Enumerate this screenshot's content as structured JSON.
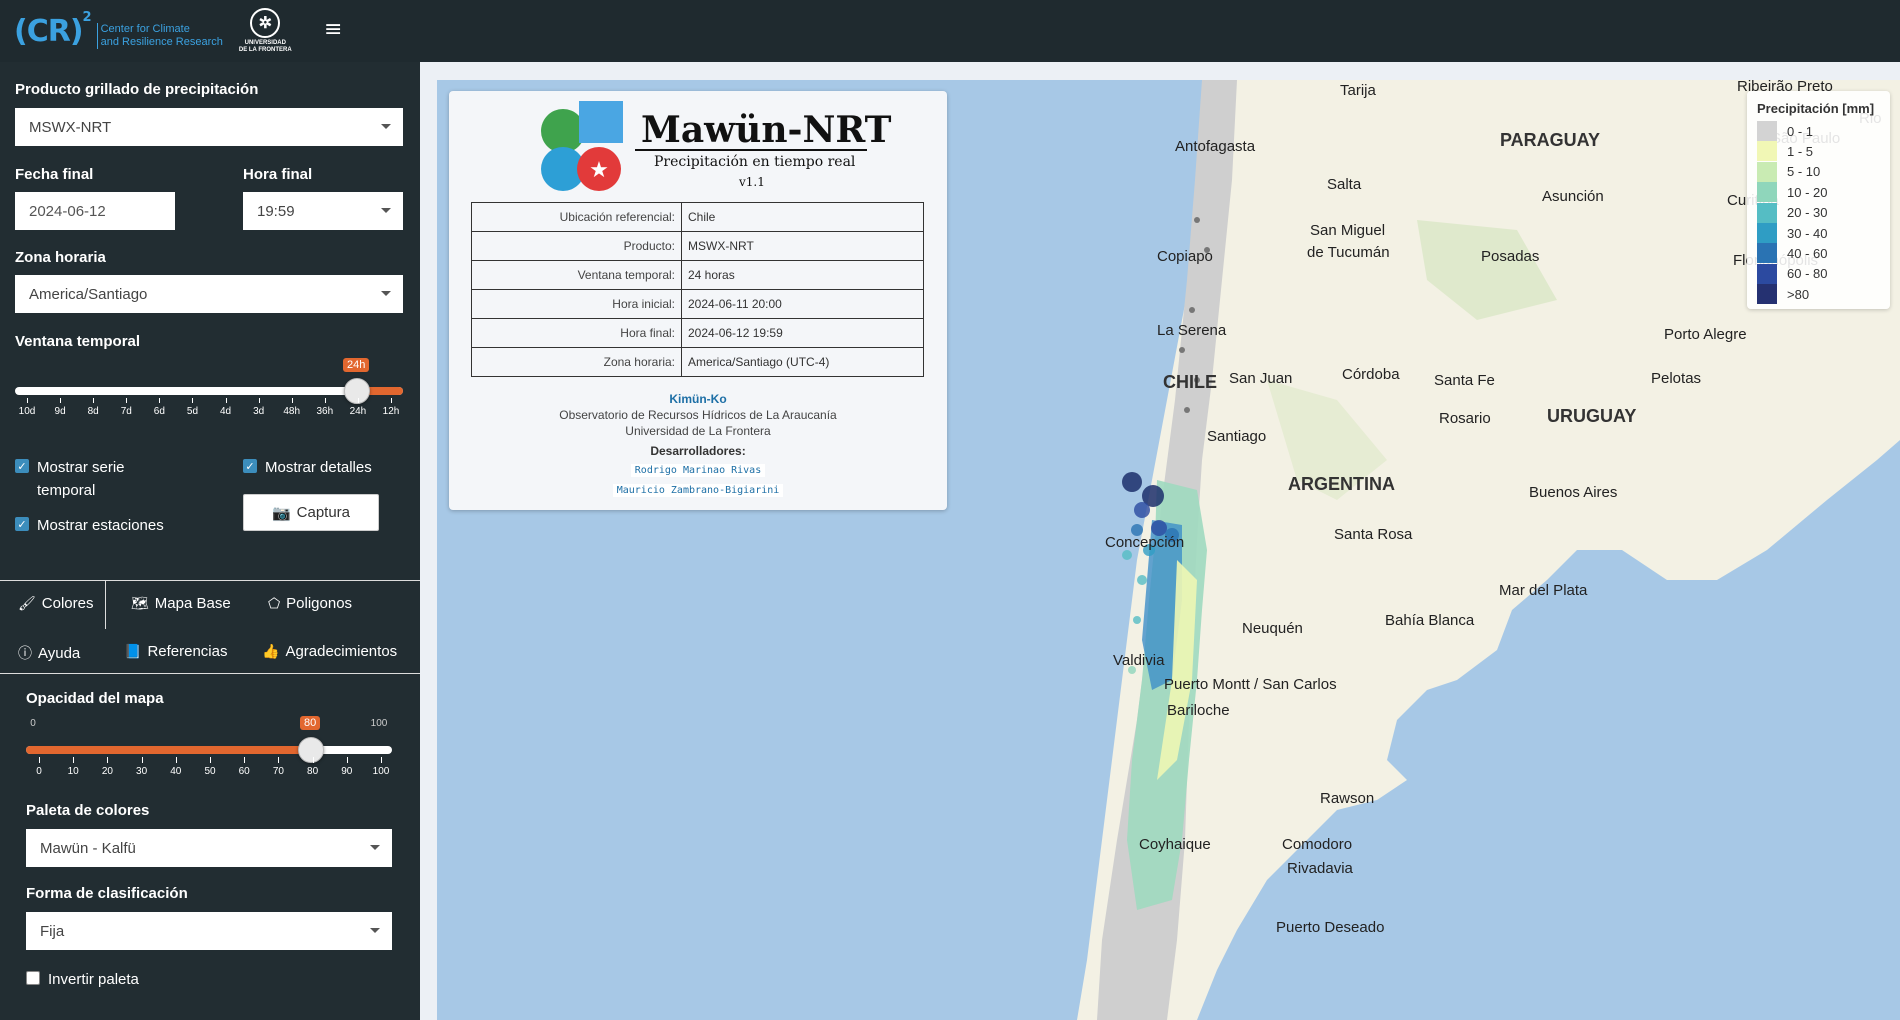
{
  "header": {
    "logo_mark": "(CR)",
    "logo_sup": "2",
    "logo_line1": "Center for Climate",
    "logo_line2": "and Resilience Research",
    "ufro_line1": "UNIVERSIDAD",
    "ufro_line2": "DE LA FRONTERA"
  },
  "sidebar": {
    "product_label": "Producto grillado de precipitación",
    "product_value": "MSWX-NRT",
    "date_label": "Fecha final",
    "date_value": "2024-06-12",
    "hour_label": "Hora final",
    "hour_value": "19:59",
    "tz_label": "Zona horaria",
    "tz_value": "America/Santiago",
    "window_label": "Ventana temporal",
    "window_value": "24h",
    "window_ticks": [
      "10d",
      "9d",
      "8d",
      "7d",
      "6d",
      "5d",
      "4d",
      "3d",
      "48h",
      "36h",
      "24h",
      "12h"
    ],
    "check_series": "Mostrar serie temporal",
    "check_series_line1": "Mostrar serie",
    "check_series_line2": "temporal",
    "check_details": "Mostrar detalles",
    "check_stations": "Mostrar estaciones",
    "capture_button": "Captura"
  },
  "tabs": [
    {
      "label": "Colores",
      "icon": "brush-icon",
      "active": true
    },
    {
      "label": "Mapa Base",
      "icon": "map-icon"
    },
    {
      "label": "Poligonos",
      "icon": "polygon-icon"
    },
    {
      "label": "Ayuda",
      "icon": "info-icon"
    },
    {
      "label": "Referencias",
      "icon": "book-icon"
    },
    {
      "label": "Agradecimientos",
      "icon": "thumbs-up-icon"
    }
  ],
  "colores": {
    "opacity_label": "Opacidad del mapa",
    "opacity_value": "80",
    "opacity_min": "0",
    "opacity_max": "100",
    "opacity_ticks": [
      "0",
      "10",
      "20",
      "30",
      "40",
      "50",
      "60",
      "70",
      "80",
      "90",
      "100"
    ],
    "palette_label": "Paleta de colores",
    "palette_value": "Mawün - Kalfü",
    "class_label": "Forma de clasificación",
    "class_value": "Fija",
    "invert_label": "Invertir paleta"
  },
  "info_card": {
    "title": "Mawün-NRT",
    "subtitle": "Precipitación en tiempo real",
    "version": "v1.1",
    "rows": [
      {
        "k": "Ubicación referencial:",
        "v": "Chile"
      },
      {
        "k": "Producto:",
        "v": "MSWX-NRT"
      },
      {
        "k": "Ventana temporal:",
        "v": "24 horas"
      },
      {
        "k": "Hora inicial:",
        "v": "2024-06-11 20:00"
      },
      {
        "k": "Hora final:",
        "v": "2024-06-12 19:59"
      },
      {
        "k": "Zona horaria:",
        "v": "America/Santiago (UTC-4)"
      }
    ],
    "kimun": "Kimün-Ko",
    "org1": "Observatorio de Recursos Hídricos de La Araucanía",
    "org2": "Universidad de La Frontera",
    "devs_label": "Desarrolladores:",
    "dev1": "Rodrigo Marinao Rivas",
    "dev2": "Mauricio Zambrano-Bigiarini"
  },
  "legend": {
    "title": "Precipitación [mm]",
    "items": [
      {
        "label": "0 - 1",
        "color": "#d3d3d3"
      },
      {
        "label": "1 - 5",
        "color": "#f1f7b5"
      },
      {
        "label": "5 - 10",
        "color": "#c9ebb3"
      },
      {
        "label": "10 - 20",
        "color": "#8fd6bb"
      },
      {
        "label": "20 - 30",
        "color": "#55bdc4"
      },
      {
        "label": "30 - 40",
        "color": "#2f9dc4"
      },
      {
        "label": "40 - 60",
        "color": "#2a73b3"
      },
      {
        "label": "60 - 80",
        "color": "#2c4aa0"
      },
      {
        "label": ">80",
        "color": "#253171"
      }
    ]
  },
  "map_labels": [
    "Tarija",
    "Ribeirão Preto",
    "PARAGUAY",
    "Antofagasta",
    "Salta",
    "Asunción",
    "Curitiba",
    "San Miguel",
    "de Tucumán",
    "Posadas",
    "Florianópolis",
    "Copiapo",
    "La Serena",
    "Porto Alegre",
    "CHILE",
    "San Juan",
    "Córdoba",
    "Santa Fe",
    "Pelotas",
    "Rosario",
    "URUGUAY",
    "Santiago",
    "ARGENTINA",
    "Buenos Aires",
    "Santa Rosa",
    "Concepción",
    "Mar del Plata",
    "Bahía Blanca",
    "Neuquén",
    "Valdivia",
    "Puerto Montt / San Carlos",
    "Bariloche",
    "Rawson",
    "Coyhaique",
    "Comodoro",
    "Rivadavia",
    "Puerto Deseado",
    "São Paulo",
    "Rio"
  ]
}
